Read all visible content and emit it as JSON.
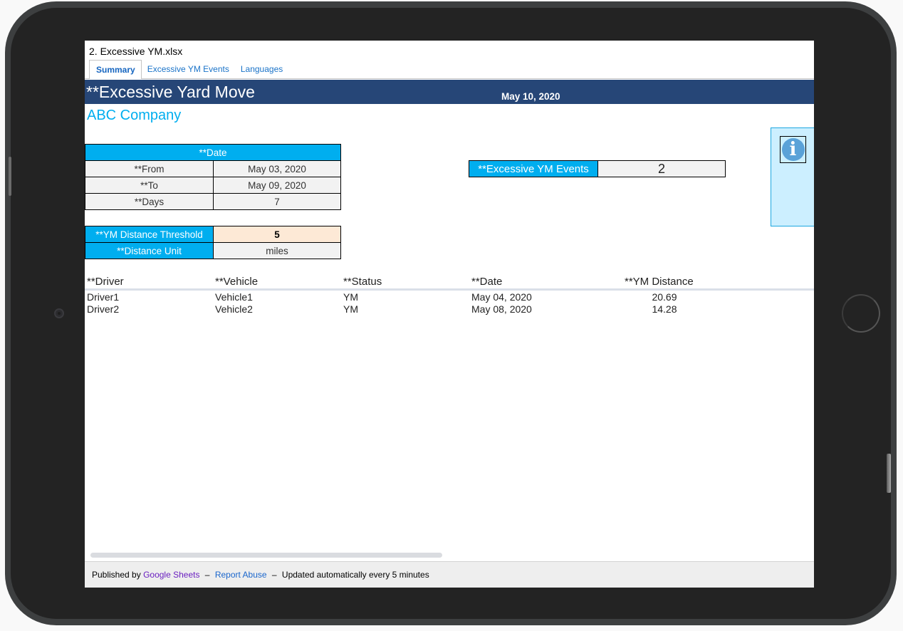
{
  "document": {
    "title": "2. Excessive YM.xlsx",
    "tabs": [
      {
        "label": "Summary",
        "active": true
      },
      {
        "label": "Excessive YM Events",
        "active": false
      },
      {
        "label": "Languages",
        "active": false
      }
    ]
  },
  "banner": {
    "title": "**Excessive Yard Move",
    "date": "May 10, 2020"
  },
  "company": "ABC Company",
  "date_table": {
    "header": "**Date",
    "rows": [
      {
        "label": "**From",
        "value": "May 03, 2020"
      },
      {
        "label": "**To",
        "value": "May 09, 2020"
      },
      {
        "label": "**Days",
        "value": "7"
      }
    ]
  },
  "threshold_table": {
    "threshold_label": "**YM Distance Threshold",
    "threshold_value": "5",
    "unit_label": "**Distance Unit",
    "unit_value": "miles"
  },
  "events_summary": {
    "label": "**Excessive YM Events",
    "value": "2"
  },
  "info_panel": {
    "icon": "info-icon",
    "glyph": "i"
  },
  "events_list": {
    "columns": [
      "**Driver",
      "**Vehicle",
      "**Status",
      "**Date",
      "**YM Distance"
    ],
    "rows": [
      [
        "Driver1",
        "Vehicle1",
        "YM",
        "May 04, 2020",
        "20.69"
      ],
      [
        "Driver2",
        "Vehicle2",
        "YM",
        "May 08, 2020",
        "14.28"
      ]
    ]
  },
  "footer": {
    "published_by": "Published by",
    "google_sheets": "Google Sheets",
    "dash": "–",
    "report_abuse": "Report Abuse",
    "updated": "Updated automatically every 5 minutes"
  },
  "colors": {
    "banner": "#264677",
    "accent": "#00aeef",
    "threshold_cell": "#fde9d6",
    "info_panel": "#ccefff"
  }
}
